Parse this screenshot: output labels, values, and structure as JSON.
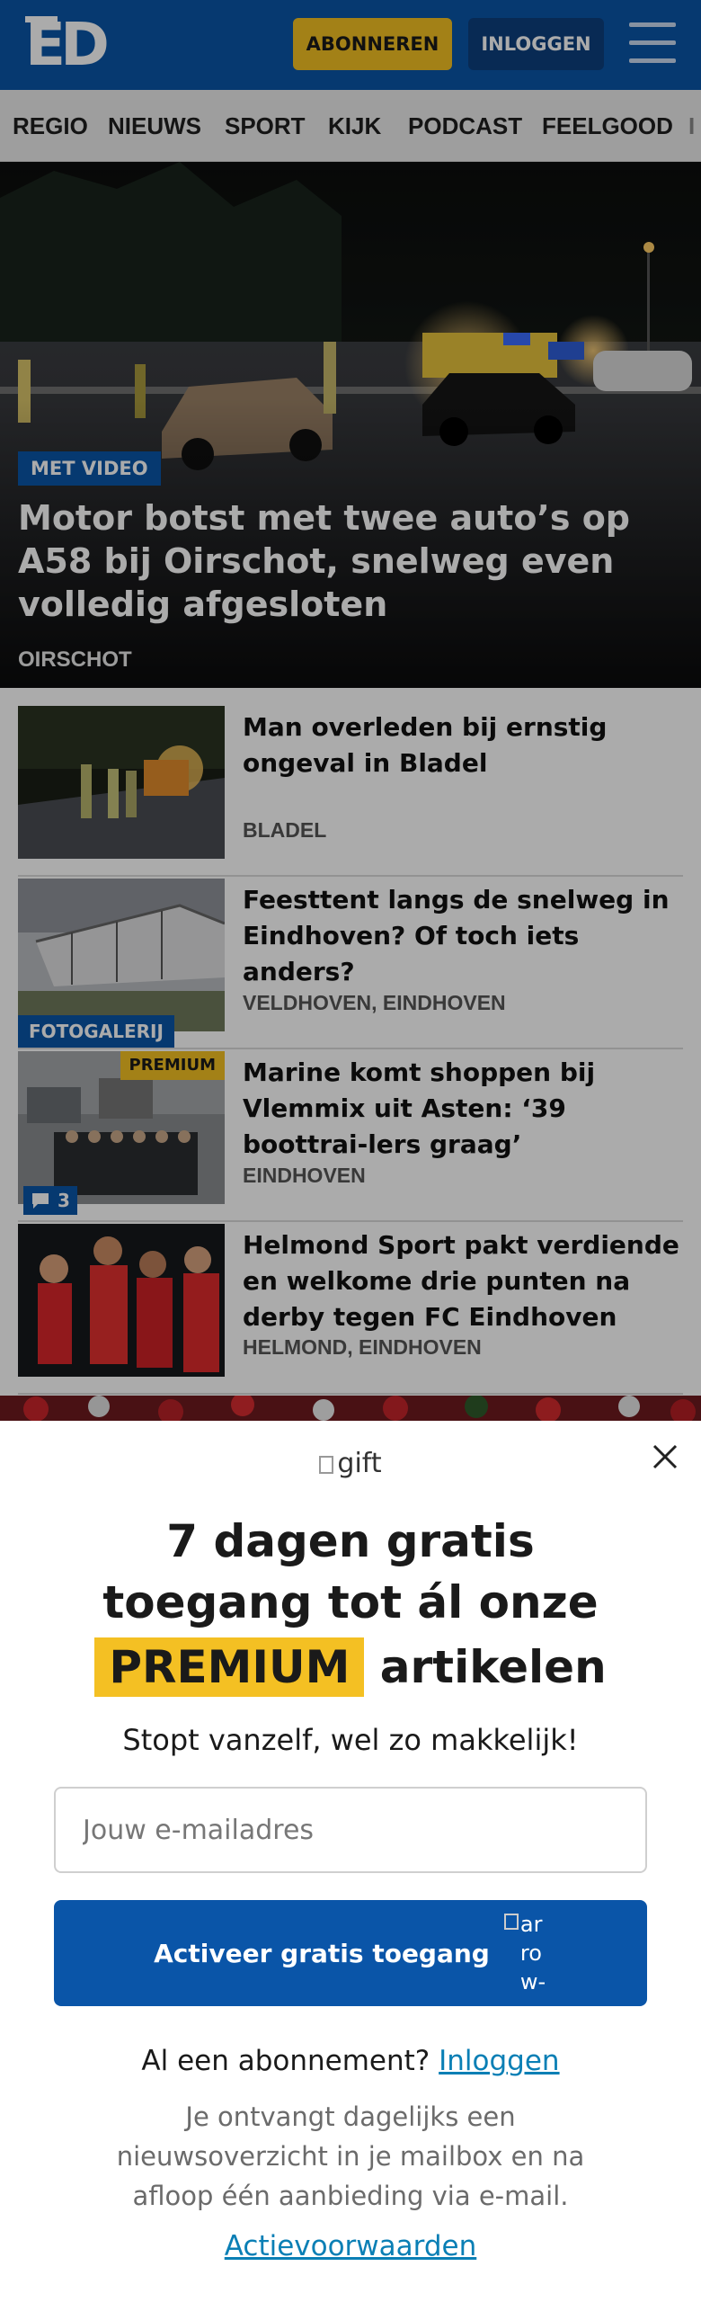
{
  "header": {
    "logo": "ED",
    "subscribe_label": "ABONNEREN",
    "login_label": "INLOGGEN",
    "menu_icon": "hamburger-icon"
  },
  "nav": {
    "items": [
      "REGIO",
      "NIEUWS",
      "SPORT",
      "KIJK",
      "PODCAST",
      "FEELGOOD",
      "I"
    ]
  },
  "hero": {
    "badge": "MET VIDEO",
    "title": "Motor botst met twee auto’s op A58 bij Oirschot, snelweg even volledig afgesloten",
    "place": "OIRSCHOT"
  },
  "articles": [
    {
      "title": "Man overleden bij ernstig ongeval in Bladel",
      "place": "BLADEL"
    },
    {
      "title": "Feesttent langs de snelweg in Eindhoven? Of toch iets anders?",
      "place": "VELDHOVEN, EINDHOVEN",
      "tag": "FOTOGALERIJ"
    },
    {
      "title": "Marine komt shoppen bij Vlemmix uit Asten: ‘39 boottrai-lers graag’",
      "place": "EINDHOVEN",
      "premium": "PREMIUM",
      "comments": "3"
    },
    {
      "title": "Helmond Sport pakt verdiende en welkome drie punten na derby tegen FC Eindhoven",
      "place": "HELMOND, EINDHOVEN"
    }
  ],
  "modal": {
    "gift_alt": "gift",
    "headline_line1": "7 dagen gratis",
    "headline_line2": "toegang tot ál onze",
    "headline_premium": "PREMIUM",
    "headline_rest": "artikelen",
    "subtitle": "Stopt vanzelf, wel zo makkelijk!",
    "email_placeholder": "Jouw e-mailadres",
    "activate_label": "Activeer gratis toegang",
    "arrow_alt": "arrow-right",
    "already_text": "Al een abonnement?",
    "already_link": "Inloggen",
    "info": "Je ontvangt dagelijks een nieuwsoverzicht in je mailbox en na afloop één aanbieding via e-mail.",
    "terms": "Actievoorwaarden"
  },
  "colors": {
    "brand_blue": "#0a55a8",
    "accent_yellow": "#f4c023",
    "link": "#0a7fb5"
  }
}
